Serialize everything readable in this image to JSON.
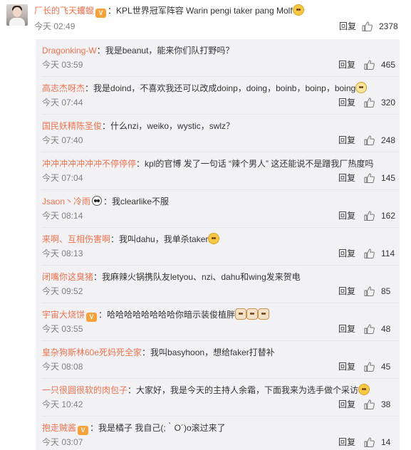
{
  "main_comment": {
    "username": "厂长的飞天蠼螋",
    "vip_badge": "V",
    "text": "：KPL世界冠军阵容 Warin pengi taker pang Molf",
    "time": "今天 02:49",
    "reply_label": "回复",
    "likes": "2378"
  },
  "replies": [
    {
      "username": "Dragonking-W",
      "text": "：我是beanut，能来你们队打野吗？",
      "time": "今天 03:59",
      "reply_label": "回复",
      "likes": "465"
    },
    {
      "username": "高志杰呀杰",
      "text": "：我是doind，不喜欢我还可以改成doinp，doing，boinb，boinp，boing",
      "time": "今天 07:44",
      "reply_label": "回复",
      "likes": "320"
    },
    {
      "username": "国民妖精陈圣俊",
      "text": "：什么nzi，weiko，wystic，swlz？",
      "time": "今天 07:40",
      "reply_label": "回复",
      "likes": "248"
    },
    {
      "username": "冲冲冲冲冲冲冲不停停停",
      "text": "：kpl的官博 发了一句话 “辣个男人” 这还能说不是蹭我厂热度吗",
      "time": "今天 07:04",
      "reply_label": "回复",
      "likes": "145"
    },
    {
      "username": "Jsaon丶冷雨",
      "text": "：我clearlike不服",
      "time": "今天 08:14",
      "reply_label": "回复",
      "likes": "162"
    },
    {
      "username": "来啊、互相伤害啊",
      "text": "：我叫dahu，我单杀taker",
      "time": "今天 08:13",
      "reply_label": "回复",
      "likes": "114"
    },
    {
      "username": "闭嘴你这臭猪",
      "text": "：我麻辣火锅携队友letyou、nzi、dahu和wing发来贺电",
      "time": "今天 09:52",
      "reply_label": "回复",
      "likes": "85"
    },
    {
      "username": "宇宙大烧饼",
      "text": "：哈哈哈哈哈哈哈哈你暗示装俊植胖",
      "time": "今天 03:55",
      "reply_label": "回复",
      "likes": "48"
    },
    {
      "username": "皇杂狗斯林60e死妈死全家",
      "text": "：我叫basyhoon，想给faker打替补",
      "time": "今天 08:08",
      "reply_label": "回复",
      "likes": "45"
    },
    {
      "username": "一只很圆很软的肉包子",
      "text": "：大家好，我是今天的主持人余霜，下面我来为选手做个采访",
      "time": "今天 10:42",
      "reply_label": "回复",
      "likes": "38"
    },
    {
      "username": "抱走贼酱",
      "text": "：我是橘子 我自己(;｀O´)o滚过来了",
      "time": "今天 03:07",
      "reply_label": "回复",
      "likes": "14"
    }
  ],
  "icons": {
    "like": "thumbs-up-icon",
    "vip": "vip-badge-icon",
    "emoji": "smiley-emoji-icon"
  },
  "colors": {
    "username": "#eb7350",
    "time": "#808080",
    "panel_bg": "#f2f2f5"
  }
}
